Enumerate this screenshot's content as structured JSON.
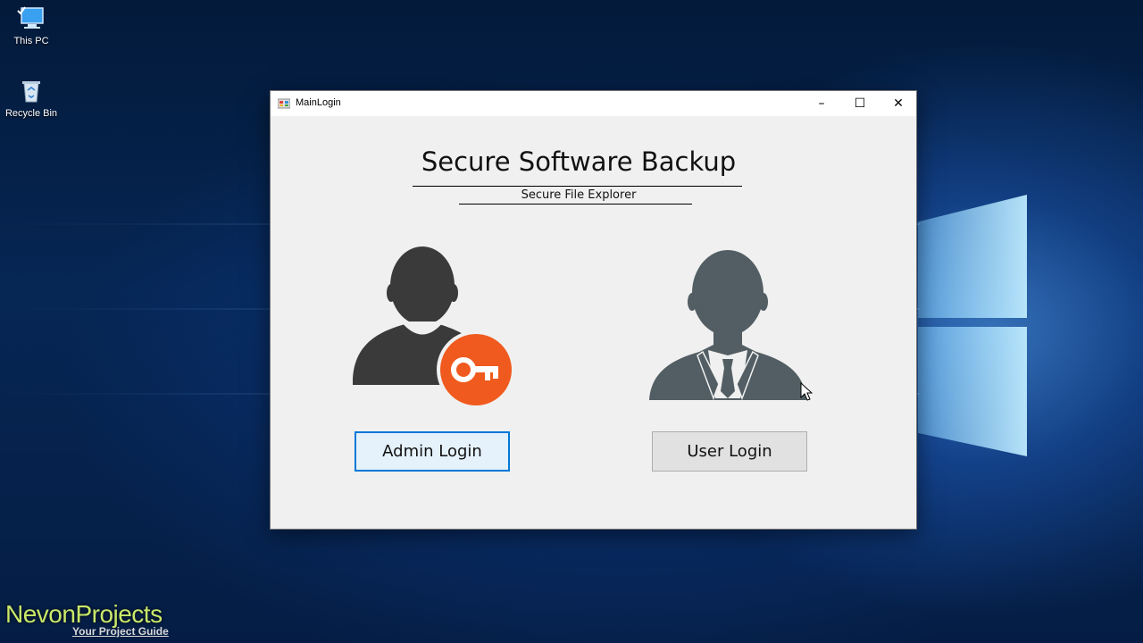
{
  "desktop": {
    "icons": [
      {
        "label": "This PC",
        "icon": "computer-icon"
      },
      {
        "label": "Recycle Bin",
        "icon": "recycle-bin-icon"
      }
    ]
  },
  "window": {
    "title": "MainLogin",
    "controls": {
      "minimize": "–",
      "maximize": "☐",
      "close": "✕"
    },
    "heading": "Secure Software Backup",
    "subheading": "Secure File Explorer",
    "admin": {
      "button_label": "Admin Login",
      "icon": "admin-user-key-icon"
    },
    "user": {
      "button_label": "User Login",
      "icon": "business-user-icon"
    }
  },
  "watermark": {
    "brand": "NevonProjects",
    "tagline": "Your Project Guide"
  },
  "colors": {
    "accent": "#0078d7",
    "key_badge": "#f05a1e",
    "admin_silhouette": "#3a3a3a",
    "user_silhouette": "#525e63"
  }
}
